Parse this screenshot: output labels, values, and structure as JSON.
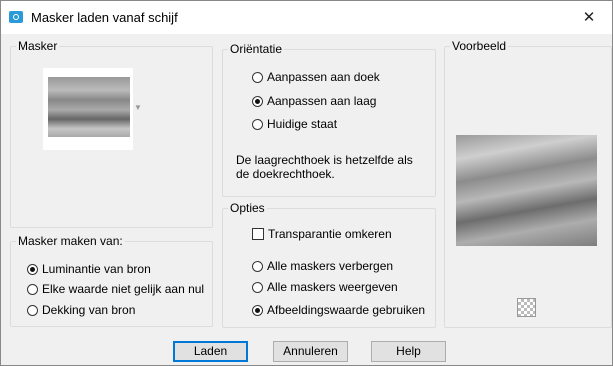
{
  "window": {
    "title": "Masker laden vanaf schijf",
    "close_glyph": "✕"
  },
  "masker": {
    "label": "Masker"
  },
  "masker_maken": {
    "label": "Masker maken van:",
    "options": [
      {
        "label": "Luminantie van bron",
        "checked": true
      },
      {
        "label": "Elke waarde niet gelijk aan nul",
        "checked": false
      },
      {
        "label": "Dekking van bron",
        "checked": false
      }
    ]
  },
  "orientatie": {
    "label": "Oriëntatie",
    "options": [
      {
        "label": "Aanpassen aan doek",
        "checked": false
      },
      {
        "label": "Aanpassen aan laag",
        "checked": true
      },
      {
        "label": "Huidige staat",
        "checked": false
      }
    ],
    "info_text": "De laagrechthoek is hetzelfde als de doekrechthoek."
  },
  "opties": {
    "label": "Opties",
    "invert": {
      "label": "Transparantie omkeren",
      "checked": false
    },
    "options": [
      {
        "label": "Alle maskers verbergen",
        "checked": false
      },
      {
        "label": "Alle maskers weergeven",
        "checked": false
      },
      {
        "label": "Afbeeldingswaarde gebruiken",
        "checked": true
      }
    ]
  },
  "voorbeeld": {
    "label": "Voorbeeld"
  },
  "buttons": {
    "load": "Laden",
    "cancel": "Annuleren",
    "help": "Help"
  }
}
